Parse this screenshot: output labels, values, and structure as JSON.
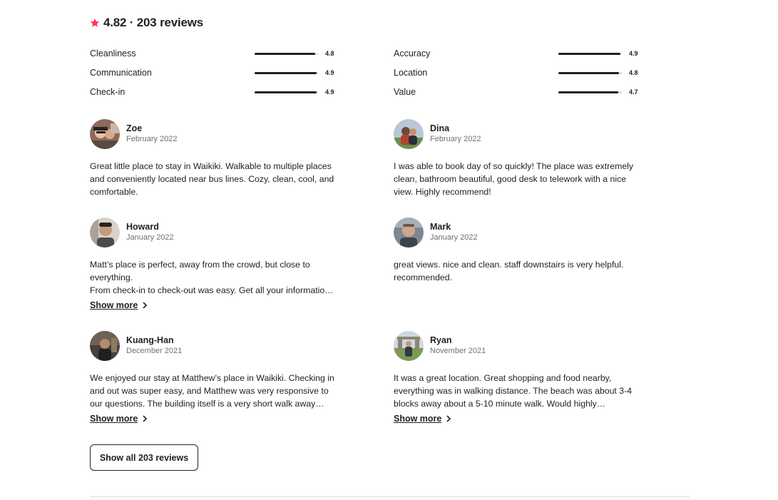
{
  "summary": {
    "rating_line": "4.82 · 203 reviews",
    "accent_color": "#FF385C"
  },
  "categories": [
    {
      "label": "Cleanliness",
      "value": "4.8",
      "score": 4.8
    },
    {
      "label": "Accuracy",
      "value": "4.9",
      "score": 4.9
    },
    {
      "label": "Communication",
      "value": "4.9",
      "score": 4.9
    },
    {
      "label": "Location",
      "value": "4.8",
      "score": 4.8
    },
    {
      "label": "Check-in",
      "value": "4.9",
      "score": 4.9
    },
    {
      "label": "Value",
      "value": "4.7",
      "score": 4.7
    }
  ],
  "reviews": [
    {
      "name": "Zoe",
      "date": "February 2022",
      "text": "Great little place to stay in Waikiki. Walkable to multiple places and conveniently located near bus lines. Cozy, clean, cool, and comfortable."
    },
    {
      "name": "Dina",
      "date": "February 2022",
      "text": "I was able to book day of so quickly! The place was extremely clean, bathroom beautiful, good desk to telework with a nice view. Highly recommend!"
    },
    {
      "name": "Howard",
      "date": "January 2022",
      "text": "Matt’s place is perfect, away from the crowd, but close to everything.\nFrom check-in to check-out was easy. Get all your informatio…",
      "show_more": "Show more"
    },
    {
      "name": "Mark",
      "date": "January 2022",
      "text": "great views. nice and clean. staff downstairs is very helpful. recommended."
    },
    {
      "name": "Kuang-Han",
      "date": "December 2021",
      "text": "We enjoyed our stay at Matthew’s place in Waikiki. Checking in and out was super easy, and Matthew was very responsive to our questions. The building itself is a very short walk away…",
      "show_more": "Show more"
    },
    {
      "name": "Ryan",
      "date": "November 2021",
      "text": "It was a great location. Great shopping and food nearby, everything was in walking distance. The beach was about 3-4 blocks away about a 5-10 minute walk. Would highly…",
      "show_more": "Show more"
    }
  ],
  "show_all_label": "Show all 203 reviews"
}
